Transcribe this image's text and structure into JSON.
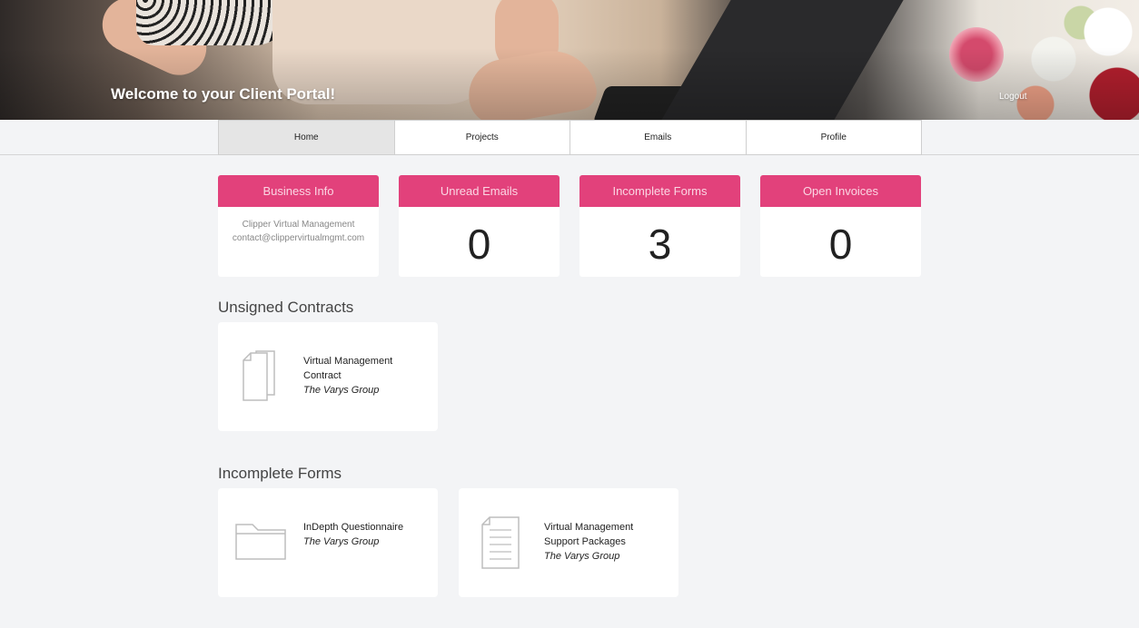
{
  "hero": {
    "title": "Welcome to your Client Portal!",
    "logout_label": "Logout"
  },
  "nav": {
    "tabs": [
      "Home",
      "Projects",
      "Emails",
      "Profile"
    ],
    "active": "Home"
  },
  "stats": {
    "business_info": {
      "title": "Business Info",
      "name": "Clipper Virtual Management",
      "email": "contact@clippervirtualmgmt.com"
    },
    "unread_emails": {
      "title": "Unread Emails",
      "value": "0"
    },
    "incomplete_forms": {
      "title": "Incomplete Forms",
      "value": "3"
    },
    "open_invoices": {
      "title": "Open Invoices",
      "value": "0"
    }
  },
  "unsigned_contracts": {
    "title": "Unsigned Contracts",
    "items": [
      {
        "line1": "Virtual Management",
        "line2": "Contract",
        "client": "The Varys Group",
        "icon": "documents-icon"
      }
    ]
  },
  "incomplete_forms": {
    "title": "Incomplete Forms",
    "items": [
      {
        "line1": "InDepth Questionnaire",
        "client": "The Varys Group",
        "icon": "folder-icon"
      },
      {
        "line1": "Virtual Management",
        "line2": "Support Packages",
        "client": "The Varys Group",
        "icon": "form-icon"
      }
    ]
  },
  "colors": {
    "accent": "#e2417b",
    "background": "#f3f4f6"
  }
}
